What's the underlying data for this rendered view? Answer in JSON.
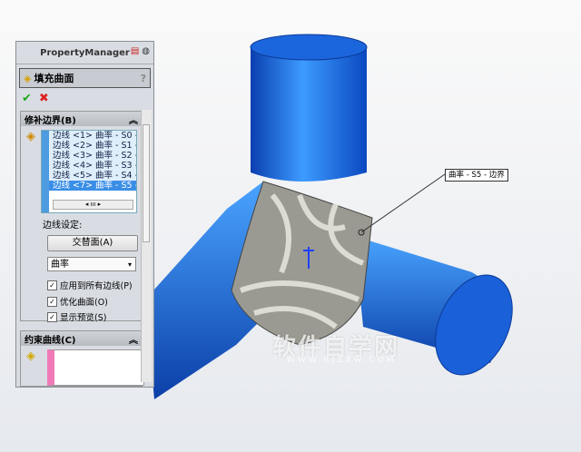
{
  "panel": {
    "title": "PropertyManager",
    "feature_title": "填充曲面",
    "help": "?",
    "ok": "✔",
    "cancel": "✖"
  },
  "patch_boundary": {
    "header": "修补边界(B)",
    "collapse": "︽",
    "items": [
      "边线 <1> 曲率 - S0 -",
      "边线 <2> 曲率 - S1 -",
      "边线 <3> 曲率 - S2 -",
      "边线 <4> 曲率 - S3 -",
      "边线 <5> 曲率 - S4 -",
      "边线 <7> 曲率 - S5 -"
    ],
    "scroll": "◂ ııı ▸",
    "edge_settings_label": "边线设定:",
    "alternate_face_button": "交替面(A)",
    "condition_select": "曲率",
    "dropdown_arrow": "▾",
    "apply_all": "应用到所有边线(P)",
    "optimize": "优化曲面(O)",
    "show_preview": "显示预览(S)",
    "check": "✓"
  },
  "constraint_curves": {
    "header": "约束曲线(C)",
    "collapse": "︽"
  },
  "viewport": {
    "callout": "曲率 - S5 - 边界",
    "watermark": "软件自学网",
    "watermark_url": "WWW.RJZXW.COM"
  },
  "colors": {
    "model_blue": "#1f6fe8",
    "selection": "#3a8ee6"
  }
}
